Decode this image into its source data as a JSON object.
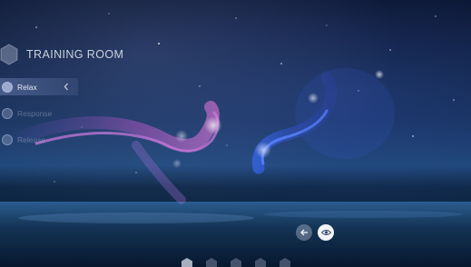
{
  "header": {
    "title": "TRAINING ROOM",
    "logo_icon": "hexagon-icon"
  },
  "menu": {
    "items": [
      {
        "label": "Relax",
        "active": true
      },
      {
        "label": "Response",
        "active": false
      },
      {
        "label": "Release",
        "active": false
      }
    ],
    "collapse_icon": "chevron-left-icon"
  },
  "controls": {
    "back_icon": "arrow-left-icon",
    "view_icon": "eye-icon"
  },
  "pagination": {
    "count": 5,
    "icon": "hexagon-icon"
  },
  "colors": {
    "sky_top": "#0b1530",
    "horizon": "#1f4779",
    "pink_ribbon": "#e06ad6",
    "blue_ribbon": "#3f63ff",
    "active_menu": "#7a8cbe"
  }
}
